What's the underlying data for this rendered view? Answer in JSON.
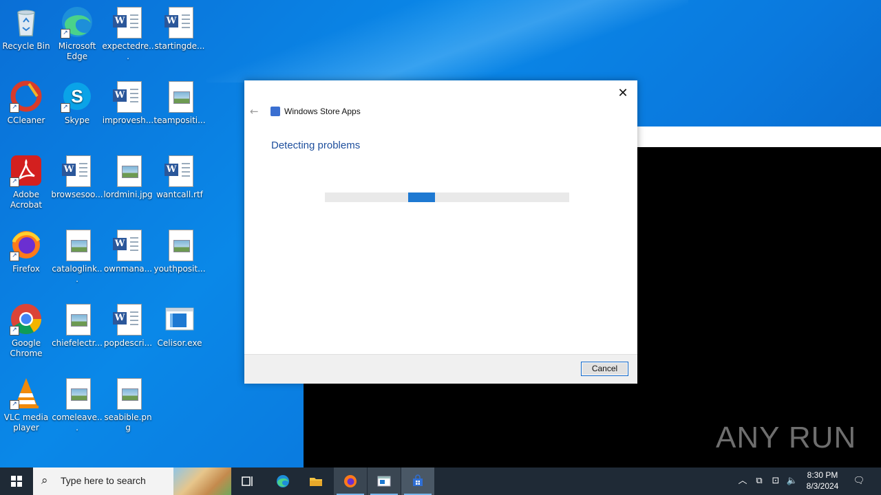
{
  "desktop": {
    "icons": [
      {
        "label": "Recycle Bin",
        "icon": "recycle-bin-icon"
      },
      {
        "label": "Microsoft Edge",
        "icon": "edge-icon"
      },
      {
        "label": "expectedre...",
        "icon": "word-doc-icon"
      },
      {
        "label": "startingde...",
        "icon": "word-doc-icon"
      },
      {
        "label": "CCleaner",
        "icon": "ccleaner-icon"
      },
      {
        "label": "Skype",
        "icon": "skype-icon"
      },
      {
        "label": "improvesh...",
        "icon": "word-doc-icon"
      },
      {
        "label": "teampositi...",
        "icon": "image-file-icon"
      },
      {
        "label": "Adobe Acrobat",
        "icon": "acrobat-icon"
      },
      {
        "label": "browsesoo...",
        "icon": "word-doc-icon"
      },
      {
        "label": "lordmini.jpg",
        "icon": "image-file-icon"
      },
      {
        "label": "wantcall.rtf",
        "icon": "word-doc-icon"
      },
      {
        "label": "Firefox",
        "icon": "firefox-icon"
      },
      {
        "label": "cataloglink...",
        "icon": "image-file-icon"
      },
      {
        "label": "ownmana...",
        "icon": "word-doc-icon"
      },
      {
        "label": "youthposit...",
        "icon": "image-file-icon"
      },
      {
        "label": "Google Chrome",
        "icon": "chrome-icon"
      },
      {
        "label": "chiefelectr...",
        "icon": "image-file-icon"
      },
      {
        "label": "popdescri...",
        "icon": "word-doc-icon"
      },
      {
        "label": "Celisor.exe",
        "icon": "exe-icon"
      },
      {
        "label": "VLC media player",
        "icon": "vlc-icon"
      },
      {
        "label": "comeleave...",
        "icon": "image-file-icon"
      },
      {
        "label": "seabible.png",
        "icon": "image-file-icon"
      }
    ]
  },
  "dialog": {
    "app_title": "Windows Store Apps",
    "heading": "Detecting problems",
    "cancel_label": "Cancel",
    "close_glyph": "✕",
    "back_glyph": "←",
    "colors": {
      "heading": "#1d4e9c",
      "progress": "#1e79d2"
    }
  },
  "taskbar": {
    "search_placeholder": "Type here to search",
    "apps": [
      "task-view",
      "edge",
      "file-explorer",
      "firefox",
      "troubleshooter-window",
      "store-troubleshooter"
    ],
    "time": "8:30 PM",
    "date": "8/3/2024"
  },
  "watermark": "ANY RUN"
}
